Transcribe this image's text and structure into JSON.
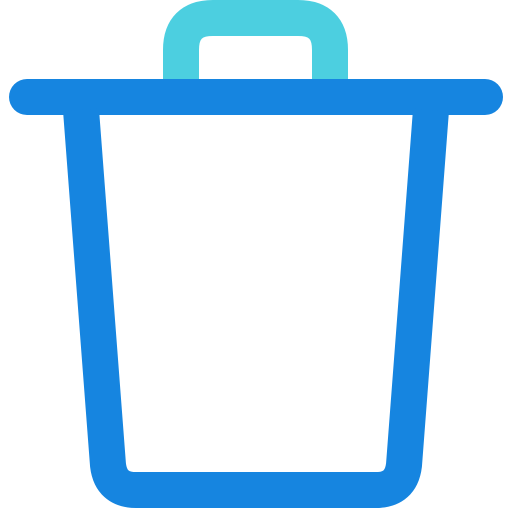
{
  "icon": {
    "name": "trash-can-icon",
    "colors": {
      "body": "#1685e0",
      "handle": "#4ccfe0",
      "background": "#ffffff"
    }
  }
}
